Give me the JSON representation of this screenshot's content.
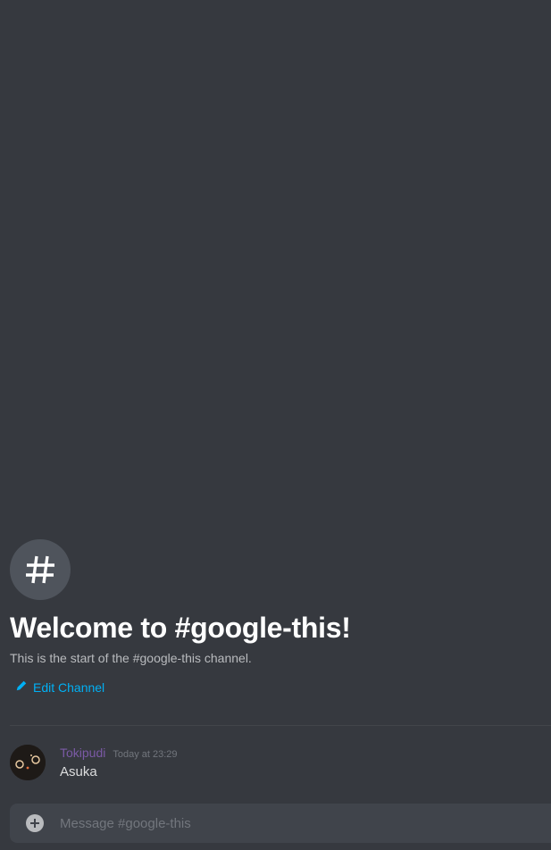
{
  "channel": {
    "icon": "hash-icon",
    "welcome_title": "Welcome to #google-this!",
    "welcome_subtitle": "This is the start of the #google-this channel.",
    "edit_label": "Edit Channel",
    "edit_icon": "pencil-icon"
  },
  "messages": [
    {
      "username": "Tokipudi",
      "timestamp": "Today at 23:29",
      "text": "Asuka",
      "username_color": "#7b5aa6"
    }
  ],
  "composer": {
    "placeholder": "Message #google-this",
    "attach_icon": "plus-circle-icon"
  },
  "colors": {
    "background": "#36393f",
    "link": "#00b0f4",
    "input_background": "#40444b"
  }
}
